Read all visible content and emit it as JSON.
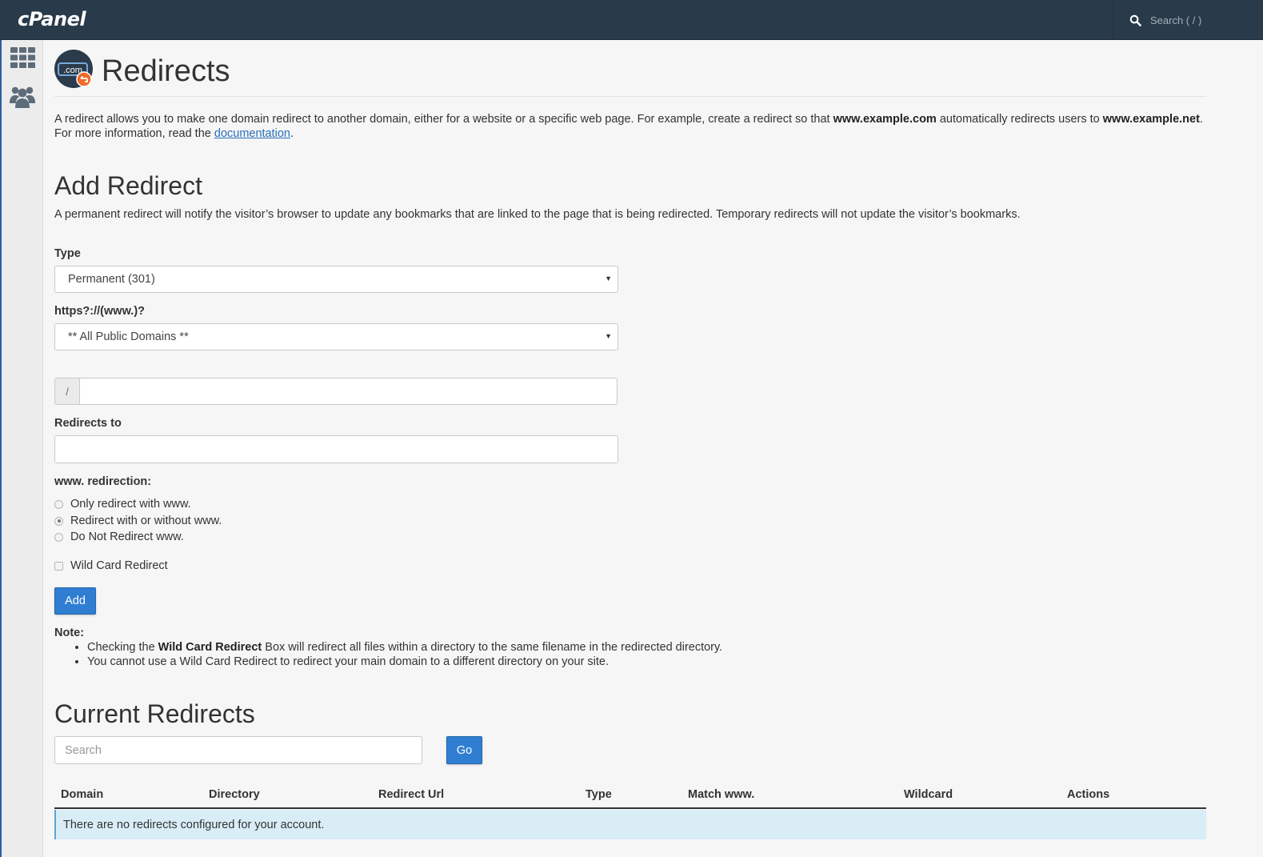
{
  "topbar": {
    "logo_text": "cPanel",
    "search_placeholder": "Search ( / )"
  },
  "sidebar": {
    "items": [
      {
        "icon": "grid-icon",
        "label": "Tools"
      },
      {
        "icon": "users-icon",
        "label": "Users"
      }
    ]
  },
  "page": {
    "title": "Redirects",
    "icon_text": ".com",
    "intro_1": "A redirect allows you to make one domain redirect to another domain, either for a website or a specific web page. For example, create a redirect so that ",
    "intro_domain_1": "www.example.com",
    "intro_2": " automatically redirects users to ",
    "intro_domain_2": "www.example.net",
    "intro_3": ". For more information, read the ",
    "intro_link": "documentation",
    "intro_4": "."
  },
  "add_redirect": {
    "heading": "Add Redirect",
    "description": "A permanent redirect will notify the visitor’s browser to update any bookmarks that are linked to the page that is being redirected. Temporary redirects will not update the visitor’s bookmarks.",
    "type_label": "Type",
    "type_value": "Permanent (301)",
    "domain_label": "https?://(www.)?",
    "domain_value": "** All Public Domains **",
    "path_prefix": "/",
    "path_value": "",
    "redirects_to_label": "Redirects to",
    "redirects_to_value": "",
    "www_label": "www. redirection:",
    "www_options": [
      {
        "label": "Only redirect with www.",
        "checked": false
      },
      {
        "label": "Redirect with or without www.",
        "checked": true
      },
      {
        "label": "Do Not Redirect www.",
        "checked": false
      }
    ],
    "wildcard_label": "Wild Card Redirect",
    "wildcard_checked": false,
    "add_button": "Add",
    "note_title": "Note:",
    "note_1_a": "Checking the ",
    "note_1_b": "Wild Card Redirect",
    "note_1_c": " Box will redirect all files within a directory to the same filename in the redirected directory.",
    "note_2": "You cannot use a Wild Card Redirect to redirect your main domain to a different directory on your site."
  },
  "current_redirects": {
    "heading": "Current Redirects",
    "search_placeholder": "Search",
    "go_button": "Go",
    "columns": [
      "Domain",
      "Directory",
      "Redirect Url",
      "Type",
      "Match www.",
      "Wildcard",
      "Actions"
    ],
    "empty_message": "There are no redirects configured for your account."
  },
  "colors": {
    "topbar": "#293a4a",
    "primary_button": "#2f7ed2",
    "info_row": "#d9edf7",
    "link": "#2a6ebb"
  }
}
